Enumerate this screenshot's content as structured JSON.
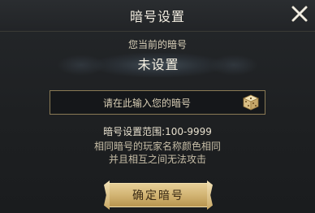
{
  "dialog": {
    "title": "暗号设置",
    "prompt_label": "您当前的暗号",
    "current_code": "未设置",
    "input": {
      "placeholder": "请在此输入您的暗号",
      "value": ""
    },
    "range_text": "暗号设置范围:100-9999",
    "note_line1": "相同暗号的玩家名称颜色相同",
    "note_line2": "并且相互之间无法攻击",
    "confirm_label": "确定暗号"
  },
  "icons": {
    "close": "close-icon",
    "dice": "dice-icon"
  },
  "colors": {
    "accent_gold": "#d2b473",
    "panel_bg": "#1d1f21",
    "text_light": "#f1ece0"
  }
}
